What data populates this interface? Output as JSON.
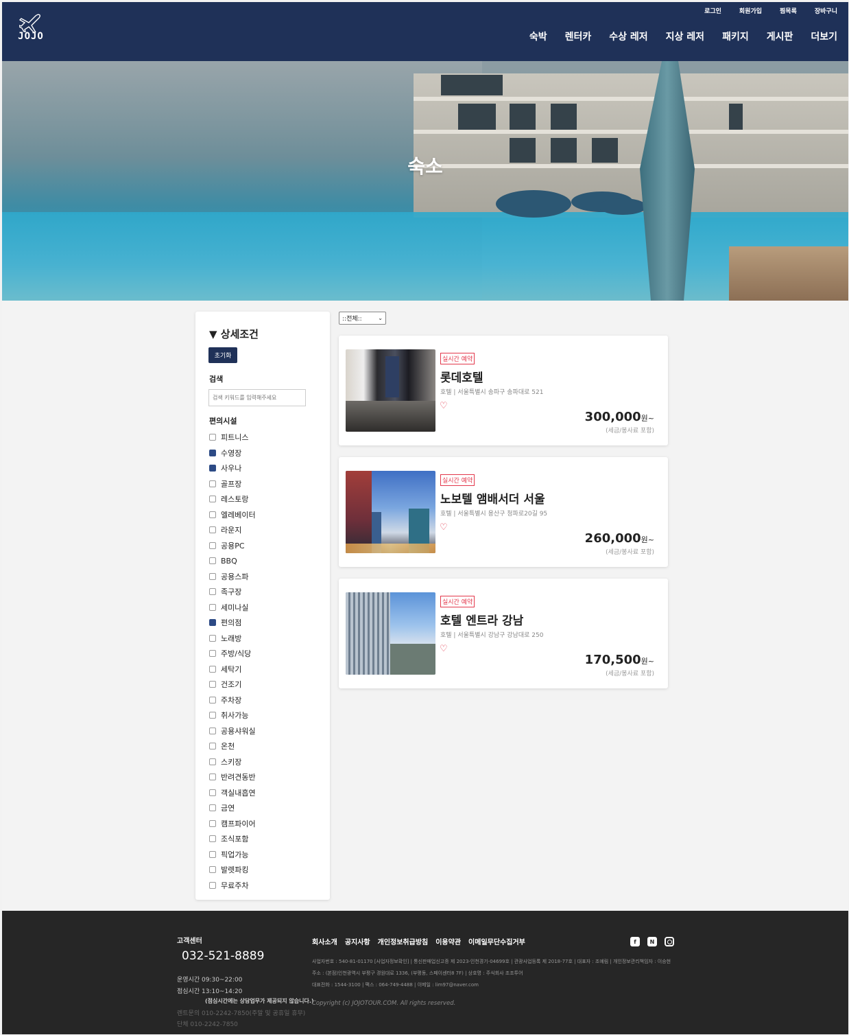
{
  "header": {
    "logo_text": "JOJO",
    "top_links": [
      "로그인",
      "회원가입",
      "찜목록",
      "장바구니"
    ],
    "nav": [
      "숙박",
      "렌터카",
      "수상 레저",
      "지상 레저",
      "패키지",
      "게시판",
      "더보기"
    ]
  },
  "hero": {
    "title": "숙소"
  },
  "sidebar": {
    "title": "상세조건",
    "reset_label": "초기화",
    "search_label": "검색",
    "search_placeholder": "검색 키워드를 입력해주세요",
    "facilities_label": "편의시설",
    "facilities": [
      {
        "label": "피트니스",
        "checked": false
      },
      {
        "label": "수영장",
        "checked": true
      },
      {
        "label": "사우나",
        "checked": true
      },
      {
        "label": "골프장",
        "checked": false
      },
      {
        "label": "레스토랑",
        "checked": false
      },
      {
        "label": "엘레베이터",
        "checked": false
      },
      {
        "label": "라운지",
        "checked": false
      },
      {
        "label": "공용PC",
        "checked": false
      },
      {
        "label": "BBQ",
        "checked": false
      },
      {
        "label": "공용스파",
        "checked": false
      },
      {
        "label": "족구장",
        "checked": false
      },
      {
        "label": "세미나실",
        "checked": false
      },
      {
        "label": "편의점",
        "checked": true
      },
      {
        "label": "노래방",
        "checked": false
      },
      {
        "label": "주방/식당",
        "checked": false
      },
      {
        "label": "세탁기",
        "checked": false
      },
      {
        "label": "건조기",
        "checked": false
      },
      {
        "label": "주차장",
        "checked": false
      },
      {
        "label": "취사가능",
        "checked": false
      },
      {
        "label": "공용샤워실",
        "checked": false
      },
      {
        "label": "온천",
        "checked": false
      },
      {
        "label": "스키장",
        "checked": false
      },
      {
        "label": "반려견동반",
        "checked": false
      },
      {
        "label": "객실내흡연",
        "checked": false
      },
      {
        "label": "금연",
        "checked": false
      },
      {
        "label": "캠프파이어",
        "checked": false
      },
      {
        "label": "조식포함",
        "checked": false
      },
      {
        "label": "픽업가능",
        "checked": false
      },
      {
        "label": "발렛파킹",
        "checked": false
      },
      {
        "label": "무료주차",
        "checked": false
      }
    ]
  },
  "results": {
    "sort_value": "::전체::",
    "items": [
      {
        "badge": "실시간 예약",
        "name": "롯데호텔",
        "meta": "호텔 | 서울특별시 송파구 송파대로 521",
        "price": "300,000",
        "unit": "원~",
        "tax": "(세금/봉사료 포함)"
      },
      {
        "badge": "실시간 예약",
        "name": "노보텔 앰배서더 서울",
        "meta": "호텔 | 서울특별시 용산구 청파로20길 95",
        "price": "260,000",
        "unit": "원~",
        "tax": "(세금/봉사료 포함)"
      },
      {
        "badge": "실시간 예약",
        "name": "호텔 엔트라 강남",
        "meta": "호텔 | 서울특별시 강남구 강남대로 250",
        "price": "170,500",
        "unit": "원~",
        "tax": "(세금/봉사료 포함)"
      }
    ]
  },
  "footer": {
    "cs_title": "고객센터",
    "phone": "032-521-8889",
    "hours": "운영시간   09:30~22:00",
    "lunch": "점심시간   13:10~14:20",
    "lunch_note": "(점심시간에는 상담업무가 제공되지 않습니다.)",
    "rental": "렌트문의   010-2242-7850(주말 및 공휴일 휴무)",
    "group": "단체         010-2242-7850",
    "links": [
      "회사소개",
      "공지사항",
      "개인정보취급방침",
      "이용약관",
      "이메일무단수집거부"
    ],
    "info1": "사업자번호 : 540-81-01170 [사업자정보확인] | 통신판매업신고증 제 2023-인천경기-04699호 | 관광사업등록 제 2018-77호 | 대표자 : 조예림 | 개인정보관리책임자 : 이승현",
    "info2": "주소 : (본점)인천광역시 부평구 경원대로 1336, (부평동, 스페이센터8 7F) | 상호명 : 주식회사 조조투어",
    "info3": "대표전화 : 1544-3100 | 팩스 : 064-749-4488 | 이메일 : lim97@naver.com",
    "copyright": "Copyright (c) JOJOTOUR.COM. All rights reserved.",
    "social_icons": [
      "facebook-icon",
      "naver-icon",
      "instagram-icon"
    ]
  }
}
